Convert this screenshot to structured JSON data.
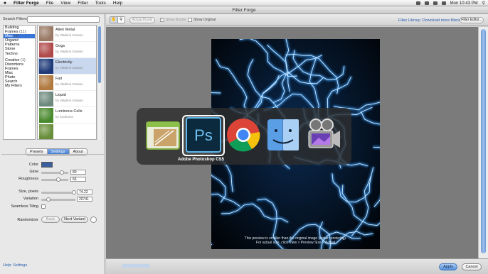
{
  "menubar": {
    "apple": "",
    "items": [
      "Filter Forge",
      "File",
      "View",
      "Filter",
      "Tools",
      "Help"
    ],
    "clock": "Mon 10:43 PM"
  },
  "window": {
    "title": "Filter Forge"
  },
  "search": {
    "label": "Search Filters:",
    "value": ""
  },
  "categories": [
    {
      "label": "Building",
      "count": "",
      "selected": false
    },
    {
      "label": "Frames",
      "count": "(11)",
      "selected": false
    },
    {
      "label": "Misc",
      "count": "(4)",
      "selected": true
    },
    {
      "label": "Organic",
      "count": "",
      "selected": false
    },
    {
      "label": "Patterns",
      "count": "",
      "selected": false
    },
    {
      "label": "Stone",
      "count": "",
      "selected": false
    },
    {
      "label": "Techno",
      "count": "",
      "selected": false
    },
    {
      "label": "",
      "count": "",
      "selected": false
    },
    {
      "label": "Creative",
      "count": "(1)",
      "selected": false
    },
    {
      "label": "Distortions",
      "count": "",
      "selected": false
    },
    {
      "label": "Frames",
      "count": "",
      "selected": false
    },
    {
      "label": "Misc",
      "count": "",
      "selected": false
    },
    {
      "label": "Photo",
      "count": "",
      "selected": false
    },
    {
      "label": "Search",
      "count": "",
      "selected": false
    },
    {
      "label": "My Filters",
      "count": "",
      "selected": false
    }
  ],
  "filters": [
    {
      "name": "Alien Metal",
      "author": "by Vladimir Golovin",
      "color": "#9a7a66",
      "selected": false
    },
    {
      "name": "Gogs",
      "author": "by Vladimir Golovin",
      "color": "#b04a4a",
      "selected": false
    },
    {
      "name": "Electricity",
      "author": "by Vladimir Golovin",
      "color": "#1e3a78",
      "selected": true
    },
    {
      "name": "Fall",
      "author": "by Vladimir Golovin",
      "color": "#b07a40",
      "selected": false
    },
    {
      "name": "Liquid",
      "author": "by Vladimir Golovin",
      "color": "#6e8a7e",
      "selected": false
    },
    {
      "name": "Luminous Cells",
      "author": "by Kochurov",
      "color": "#4a8a2e",
      "selected": false
    },
    {
      "name": "",
      "author": "",
      "color": "#6a8f3c",
      "selected": false
    }
  ],
  "tabs": [
    {
      "label": "Presets",
      "selected": false
    },
    {
      "label": "Settings",
      "selected": true
    },
    {
      "label": "About",
      "selected": false
    }
  ],
  "settings": {
    "color_label": "Color",
    "color_value": "#3a5f9e",
    "glow_label": "Glow",
    "glow_value": "80",
    "glow_fraction": 0.75,
    "roughness_label": "Roughness",
    "roughness_value": "66",
    "roughness_fraction": 0.62,
    "size_label": "Size, pixels",
    "size_value": "74.22",
    "size_fraction": 0.95,
    "variation_label": "Variation",
    "variation_value": "20741",
    "variation_fraction": 0.2,
    "seamless_label": "Seamless Tiling",
    "randomizer_label": "Randomizer",
    "back_label": "Back",
    "next_label": "Next Variant"
  },
  "status": {
    "text": "Help: Settings"
  },
  "toolbar": {
    "actual_pixels": "Actual Pixels",
    "show_border": "Show Border",
    "show_original": "Show Original",
    "library_link": "Filter Library: Download more filters",
    "filter_editor": "Filter Editor..."
  },
  "preview": {
    "note_line1": "This preview is smaller than the original image (faster rendering).",
    "note_line2": "For actual size, click View > Preview Size > Actual"
  },
  "bottom": {
    "apply": "Apply",
    "cancel": "Cancel"
  },
  "switcher": {
    "selected_label": "Adobe Photoshop CS5",
    "apps": [
      "filter-forge",
      "photoshop",
      "chrome",
      "finder",
      "imovie"
    ]
  }
}
